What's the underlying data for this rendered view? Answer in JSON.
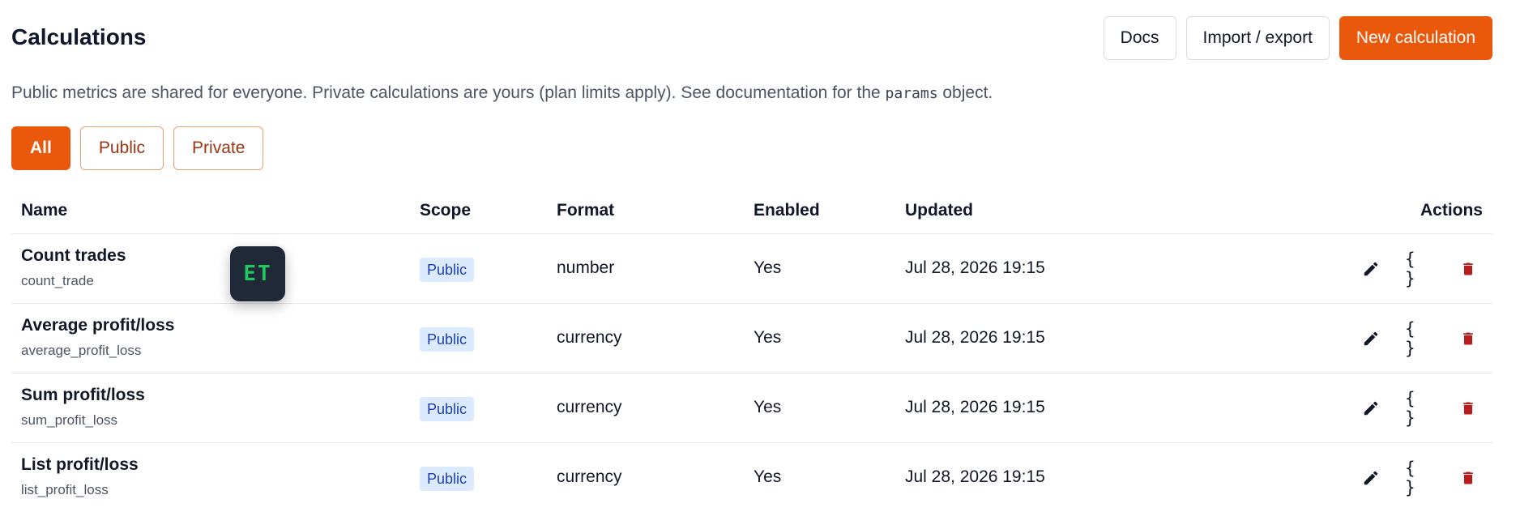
{
  "page": {
    "title": "Calculations",
    "description_pre": "Public metrics are shared for everyone. Private calculations are yours (plan limits apply). See documentation for the ",
    "description_code": "params",
    "description_post": " object."
  },
  "header_actions": {
    "docs": "Docs",
    "import_export": "Import / export",
    "new_calculation": "New calculation"
  },
  "filters": [
    {
      "label": "All",
      "active": true
    },
    {
      "label": "Public",
      "active": false
    },
    {
      "label": "Private",
      "active": false
    }
  ],
  "table": {
    "columns": {
      "name": "Name",
      "scope": "Scope",
      "format": "Format",
      "enabled": "Enabled",
      "updated": "Updated",
      "actions": "Actions"
    },
    "rows": [
      {
        "name": "Count trades",
        "key": "count_trade",
        "scope": "Public",
        "format": "number",
        "enabled": "Yes",
        "updated": "Jul 28, 2026 19:15"
      },
      {
        "name": "Average profit/loss",
        "key": "average_profit_loss",
        "scope": "Public",
        "format": "currency",
        "enabled": "Yes",
        "updated": "Jul 28, 2026 19:15"
      },
      {
        "name": "Sum profit/loss",
        "key": "sum_profit_loss",
        "scope": "Public",
        "format": "currency",
        "enabled": "Yes",
        "updated": "Jul 28, 2026 19:15"
      },
      {
        "name": "List profit/loss",
        "key": "list_profit_loss",
        "scope": "Public",
        "format": "currency",
        "enabled": "Yes",
        "updated": "Jul 28, 2026 19:15"
      }
    ],
    "row_icons": {
      "edit": "pencil-icon",
      "json": "{ }",
      "delete": "trash-icon"
    }
  },
  "overlay": {
    "app_badge": "ET"
  },
  "colors": {
    "accent": "#ea580c",
    "danger": "#b91c1c",
    "badge_bg": "#dbeafe",
    "badge_text": "#1e40af"
  }
}
